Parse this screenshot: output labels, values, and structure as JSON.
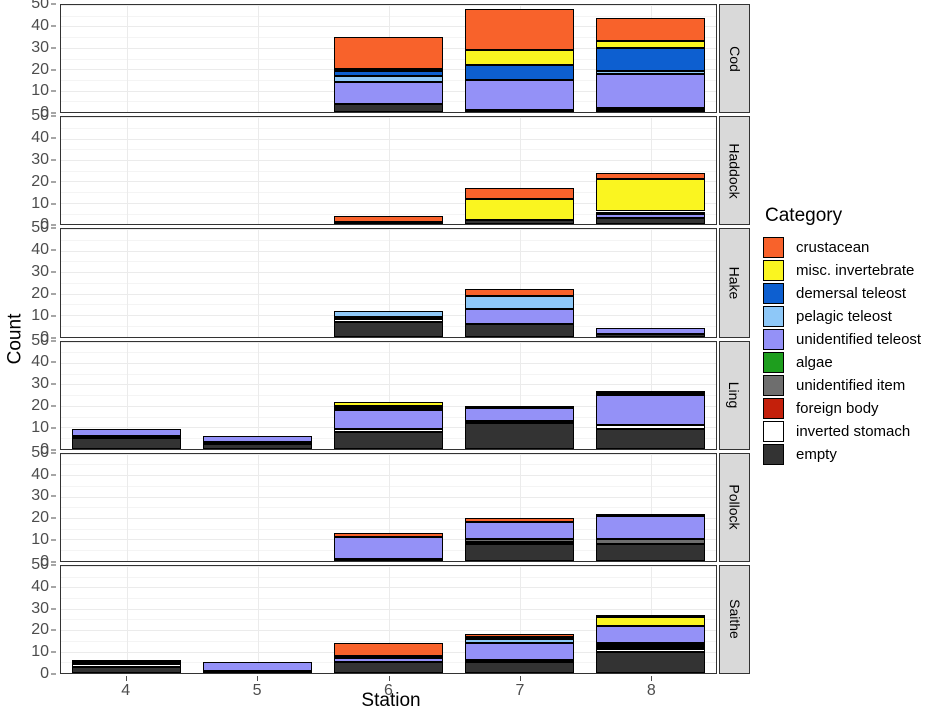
{
  "chart_data": {
    "type": "bar",
    "title": "",
    "xlabel": "Station",
    "ylabel": "Count",
    "stacked": true,
    "facet_variable": "Species",
    "facets": [
      "Cod",
      "Haddock",
      "Hake",
      "Ling",
      "Pollock",
      "Saithe"
    ],
    "categories": [
      "4",
      "5",
      "6",
      "7",
      "8"
    ],
    "x": [
      4,
      5,
      6,
      7,
      8
    ],
    "ylim": [
      0,
      50
    ],
    "yticks": [
      0,
      10,
      20,
      30,
      40,
      50
    ],
    "grid": true,
    "legend_position": "right",
    "legend_title": "Category",
    "series": [
      {
        "name": "crustacean",
        "color": "#F8622B"
      },
      {
        "name": "misc. invertebrate",
        "color": "#FAF520"
      },
      {
        "name": "demersal teleost",
        "color": "#0D5FD0"
      },
      {
        "name": "pelagic teleost",
        "color": "#8EC8F8"
      },
      {
        "name": "unidentified teleost",
        "color": "#9491F7"
      },
      {
        "name": "algae",
        "color": "#1E9E1E"
      },
      {
        "name": "unidentified item",
        "color": "#6E6E6E"
      },
      {
        "name": "foreign body",
        "color": "#C4200B"
      },
      {
        "name": "inverted stomach",
        "color": "#FFFFFF"
      },
      {
        "name": "empty",
        "color": "#333333"
      }
    ],
    "panels": [
      {
        "facet": "Cod",
        "bars": [
          {
            "station": "4",
            "total": 0,
            "segments": []
          },
          {
            "station": "5",
            "total": 0,
            "segments": []
          },
          {
            "station": "6",
            "total": 35,
            "segments": [
              {
                "category": "empty",
                "value": 4
              },
              {
                "category": "unidentified teleost",
                "value": 10
              },
              {
                "category": "pelagic teleost",
                "value": 3
              },
              {
                "category": "demersal teleost",
                "value": 2
              },
              {
                "category": "misc. invertebrate",
                "value": 1
              },
              {
                "category": "crustacean",
                "value": 15
              }
            ]
          },
          {
            "station": "7",
            "total": 48,
            "segments": [
              {
                "category": "empty",
                "value": 1
              },
              {
                "category": "unidentified teleost",
                "value": 14
              },
              {
                "category": "demersal teleost",
                "value": 7
              },
              {
                "category": "misc. invertebrate",
                "value": 7
              },
              {
                "category": "crustacean",
                "value": 19
              }
            ]
          },
          {
            "station": "8",
            "total": 44,
            "segments": [
              {
                "category": "empty",
                "value": 1
              },
              {
                "category": "inverted stomach",
                "value": 1
              },
              {
                "category": "unidentified teleost",
                "value": 16
              },
              {
                "category": "pelagic teleost",
                "value": 1
              },
              {
                "category": "demersal teleost",
                "value": 11
              },
              {
                "category": "misc. invertebrate",
                "value": 3
              },
              {
                "category": "crustacean",
                "value": 11
              }
            ]
          }
        ]
      },
      {
        "facet": "Haddock",
        "bars": [
          {
            "station": "4",
            "total": 0,
            "segments": []
          },
          {
            "station": "5",
            "total": 0,
            "segments": []
          },
          {
            "station": "6",
            "total": 4,
            "segments": [
              {
                "category": "inverted stomach",
                "value": 1
              },
              {
                "category": "crustacean",
                "value": 3
              }
            ]
          },
          {
            "station": "7",
            "total": 17,
            "segments": [
              {
                "category": "empty",
                "value": 2
              },
              {
                "category": "misc. invertebrate",
                "value": 10
              },
              {
                "category": "crustacean",
                "value": 5
              }
            ]
          },
          {
            "station": "8",
            "total": 24,
            "segments": [
              {
                "category": "empty",
                "value": 3
              },
              {
                "category": "unidentified teleost",
                "value": 2
              },
              {
                "category": "demersal teleost",
                "value": 1
              },
              {
                "category": "misc. invertebrate",
                "value": 15
              },
              {
                "category": "crustacean",
                "value": 3
              }
            ]
          }
        ]
      },
      {
        "facet": "Hake",
        "bars": [
          {
            "station": "4",
            "total": 0,
            "segments": []
          },
          {
            "station": "5",
            "total": 0,
            "segments": []
          },
          {
            "station": "6",
            "total": 12,
            "segments": [
              {
                "category": "empty",
                "value": 7
              },
              {
                "category": "inverted stomach",
                "value": 1
              },
              {
                "category": "unidentified teleost",
                "value": 1
              },
              {
                "category": "pelagic teleost",
                "value": 3
              }
            ]
          },
          {
            "station": "7",
            "total": 22,
            "segments": [
              {
                "category": "empty",
                "value": 6
              },
              {
                "category": "unidentified teleost",
                "value": 7
              },
              {
                "category": "pelagic teleost",
                "value": 6
              },
              {
                "category": "crustacean",
                "value": 3
              }
            ]
          },
          {
            "station": "8",
            "total": 4,
            "segments": [
              {
                "category": "empty",
                "value": 1
              },
              {
                "category": "unidentified teleost",
                "value": 3
              }
            ]
          }
        ]
      },
      {
        "facet": "Ling",
        "bars": [
          {
            "station": "4",
            "total": 9,
            "segments": [
              {
                "category": "empty",
                "value": 5
              },
              {
                "category": "inverted stomach",
                "value": 1
              },
              {
                "category": "unidentified teleost",
                "value": 3
              }
            ]
          },
          {
            "station": "5",
            "total": 6,
            "segments": [
              {
                "category": "empty",
                "value": 2
              },
              {
                "category": "inverted stomach",
                "value": 1
              },
              {
                "category": "unidentified teleost",
                "value": 3
              }
            ]
          },
          {
            "station": "6",
            "total": 22,
            "segments": [
              {
                "category": "empty",
                "value": 8
              },
              {
                "category": "inverted stomach",
                "value": 1
              },
              {
                "category": "unidentified teleost",
                "value": 9
              },
              {
                "category": "pelagic teleost",
                "value": 1
              },
              {
                "category": "demersal teleost",
                "value": 1
              },
              {
                "category": "misc. invertebrate",
                "value": 2
              }
            ]
          },
          {
            "station": "7",
            "total": 20,
            "segments": [
              {
                "category": "empty",
                "value": 12
              },
              {
                "category": "inverted stomach",
                "value": 1
              },
              {
                "category": "unidentified teleost",
                "value": 6
              },
              {
                "category": "foreign body",
                "value": 1
              }
            ]
          },
          {
            "station": "8",
            "total": 27,
            "segments": [
              {
                "category": "empty",
                "value": 9
              },
              {
                "category": "inverted stomach",
                "value": 2
              },
              {
                "category": "unidentified teleost",
                "value": 14
              },
              {
                "category": "pelagic teleost",
                "value": 1
              },
              {
                "category": "demersal teleost",
                "value": 1
              }
            ]
          }
        ]
      },
      {
        "facet": "Pollock",
        "bars": [
          {
            "station": "4",
            "total": 0,
            "segments": []
          },
          {
            "station": "5",
            "total": 0,
            "segments": []
          },
          {
            "station": "6",
            "total": 13,
            "segments": [
              {
                "category": "empty",
                "value": 1
              },
              {
                "category": "unidentified teleost",
                "value": 10
              },
              {
                "category": "crustacean",
                "value": 2
              }
            ]
          },
          {
            "station": "7",
            "total": 20,
            "segments": [
              {
                "category": "empty",
                "value": 8
              },
              {
                "category": "inverted stomach",
                "value": 1
              },
              {
                "category": "unidentified item",
                "value": 1
              },
              {
                "category": "unidentified teleost",
                "value": 8
              },
              {
                "category": "crustacean",
                "value": 2
              }
            ]
          },
          {
            "station": "8",
            "total": 22,
            "segments": [
              {
                "category": "empty",
                "value": 8
              },
              {
                "category": "unidentified item",
                "value": 2
              },
              {
                "category": "unidentified teleost",
                "value": 11
              },
              {
                "category": "crustacean",
                "value": 1
              }
            ]
          }
        ]
      },
      {
        "facet": "Saithe",
        "bars": [
          {
            "station": "4",
            "total": 6,
            "segments": [
              {
                "category": "empty",
                "value": 3
              },
              {
                "category": "inverted stomach",
                "value": 1
              },
              {
                "category": "unidentified teleost",
                "value": 1
              },
              {
                "category": "demersal teleost",
                "value": 1
              }
            ]
          },
          {
            "station": "5",
            "total": 5,
            "segments": [
              {
                "category": "empty",
                "value": 1
              },
              {
                "category": "unidentified teleost",
                "value": 4
              }
            ]
          },
          {
            "station": "6",
            "total": 14,
            "segments": [
              {
                "category": "empty",
                "value": 5
              },
              {
                "category": "unidentified teleost",
                "value": 2
              },
              {
                "category": "pelagic teleost",
                "value": 1
              },
              {
                "category": "crustacean",
                "value": 6
              }
            ]
          },
          {
            "station": "7",
            "total": 18,
            "segments": [
              {
                "category": "empty",
                "value": 5
              },
              {
                "category": "inverted stomach",
                "value": 1
              },
              {
                "category": "unidentified teleost",
                "value": 8
              },
              {
                "category": "pelagic teleost",
                "value": 2
              },
              {
                "category": "demersal teleost",
                "value": 1
              },
              {
                "category": "crustacean",
                "value": 1
              }
            ]
          },
          {
            "station": "8",
            "total": 27,
            "segments": [
              {
                "category": "empty",
                "value": 10
              },
              {
                "category": "inverted stomach",
                "value": 1
              },
              {
                "category": "foreign body",
                "value": 1
              },
              {
                "category": "unidentified item",
                "value": 1
              },
              {
                "category": "algae",
                "value": 1
              },
              {
                "category": "unidentified teleost",
                "value": 8
              },
              {
                "category": "misc. invertebrate",
                "value": 4
              },
              {
                "category": "crustacean",
                "value": 1
              }
            ]
          }
        ]
      }
    ]
  }
}
